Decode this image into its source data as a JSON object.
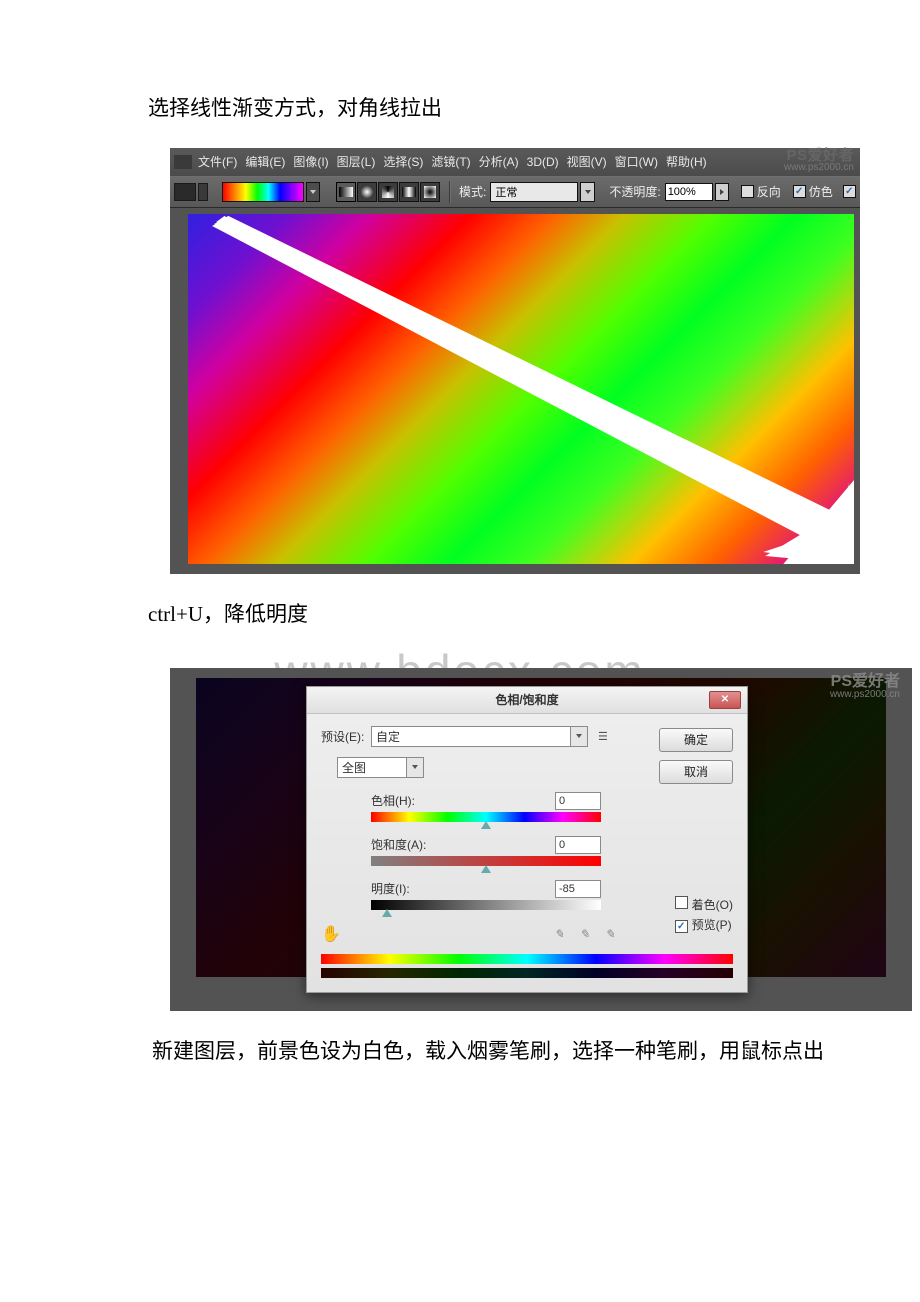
{
  "text": {
    "para1": "选择线性渐变方式，对角线拉出",
    "para2": "ctrl+U，降低明度",
    "para3": "新建图层，前景色设为白色，载入烟雾笔刷，选择一种笔刷，用鼠标点出"
  },
  "watermark_mid": "www.bdocx.com",
  "watermark_corner": {
    "line1": "PS爱好者",
    "line2": "www.ps2000.cn"
  },
  "fig1": {
    "menu": [
      "文件(F)",
      "编辑(E)",
      "图像(I)",
      "图层(L)",
      "选择(S)",
      "滤镜(T)",
      "分析(A)",
      "3D(D)",
      "视图(V)",
      "窗口(W)",
      "帮助(H)"
    ],
    "mode_label": "模式:",
    "mode_value": "正常",
    "opacity_label": "不透明度:",
    "opacity_value": "100%",
    "check_reverse": "反向",
    "check_dither": "仿色"
  },
  "fig2": {
    "title": "色相/饱和度",
    "preset_label": "预设(E):",
    "preset_value": "自定",
    "master": "全图",
    "hue_label": "色相(H):",
    "hue_value": "0",
    "sat_label": "饱和度(A):",
    "sat_value": "0",
    "light_label": "明度(I):",
    "light_value": "-85",
    "ok": "确定",
    "cancel": "取消",
    "colorize": "着色(O)",
    "preview": "预览(P)"
  }
}
